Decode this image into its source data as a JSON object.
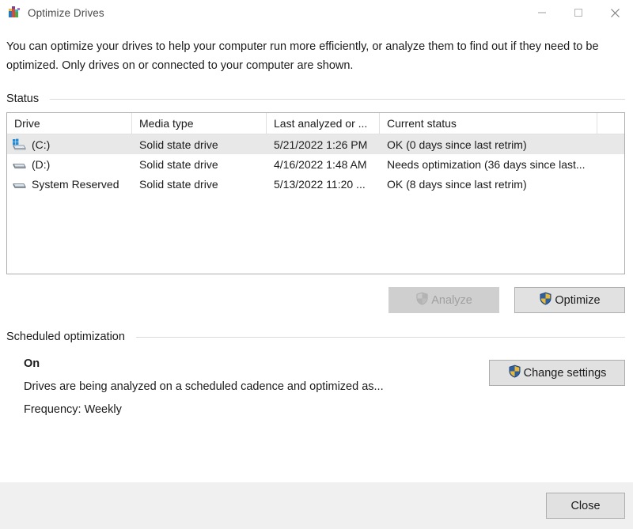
{
  "window": {
    "title": "Optimize Drives",
    "icon": "defrag-icon",
    "controls": {
      "minimize": "Minimize",
      "maximize": "Maximize",
      "close": "Close"
    }
  },
  "description": "You can optimize your drives to help your computer run more efficiently, or analyze them to find out if they need to be optimized. Only drives on or connected to your computer are shown.",
  "status_group": {
    "label": "Status",
    "table": {
      "columns": [
        "Drive",
        "Media type",
        "Last analyzed or ...",
        "Current status"
      ],
      "rows": [
        {
          "icon": "system-drive-icon",
          "drive": "(C:)",
          "media_type": "Solid state drive",
          "last_analyzed": "5/21/2022 1:26 PM",
          "current_status": "OK (0 days since last retrim)",
          "selected": true
        },
        {
          "icon": "drive-icon",
          "drive": "(D:)",
          "media_type": "Solid state drive",
          "last_analyzed": "4/16/2022 1:48 AM",
          "current_status": "Needs optimization (36 days since last...",
          "selected": false
        },
        {
          "icon": "drive-icon",
          "drive": "System Reserved",
          "media_type": "Solid state drive",
          "last_analyzed": "5/13/2022 11:20 ...",
          "current_status": "OK (8 days since last retrim)",
          "selected": false
        }
      ]
    },
    "analyze_label": "Analyze",
    "analyze_enabled": false,
    "optimize_label": "Optimize",
    "optimize_enabled": true
  },
  "scheduled_group": {
    "label": "Scheduled optimization",
    "state": "On",
    "detail": "Drives are being analyzed on a scheduled cadence and optimized as...",
    "frequency": "Frequency: Weekly",
    "change_settings_label": "Change settings"
  },
  "footer": {
    "close_label": "Close"
  },
  "colors": {
    "shield_blue": "#2f5f9e",
    "shield_gold": "#e8b838",
    "selection_gray": "#e8e8e8",
    "border_gray": "#adadad",
    "button_face": "#e1e1e1",
    "bottom_bar": "#f0f0f0"
  }
}
